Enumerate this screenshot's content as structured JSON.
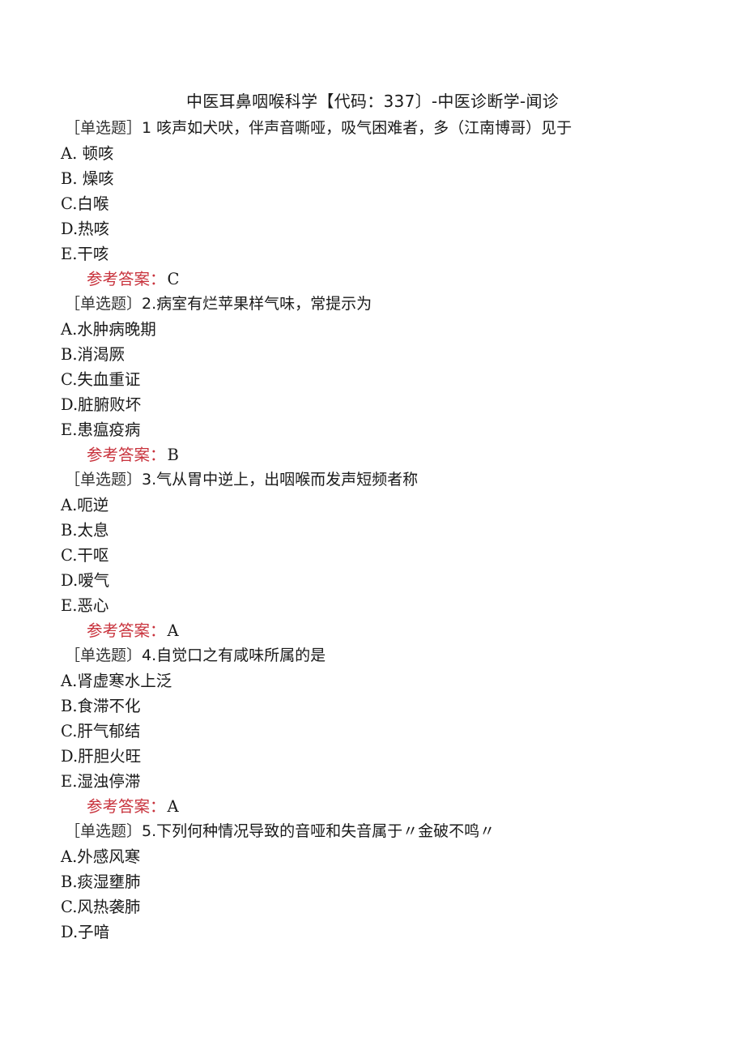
{
  "document": {
    "title": "中医耳鼻咽喉科学【代码：337〕-中医诊断学-闻诊",
    "answer_label": "参考答案：",
    "accent_color": "#c8323c",
    "questions": [
      {
        "type": "［单选题］",
        "stem": "1 咳声如犬吠，伴声音嘶哑，吸气困难者，多（江南博哥）见于",
        "options": [
          "A. 顿咳",
          "B. 燥咳",
          "C.白喉",
          "D.热咳",
          "E.干咳"
        ],
        "answer": "C"
      },
      {
        "type": "［单选题〕",
        "stem": "2.病室有烂苹果样气味，常提示为",
        "options": [
          "A.水肿病晚期",
          "B.消渴厥",
          "C.失血重证",
          "D.脏腑败坏",
          "E.患瘟疫病"
        ],
        "answer": "B"
      },
      {
        "type": "［单选题〕",
        "stem": "3.气从胃中逆上，出咽喉而发声短频者称",
        "options": [
          "A.呃逆",
          "B.太息",
          "C.干呕",
          "D.嗳气",
          "E.恶心"
        ],
        "answer": "A"
      },
      {
        "type": "［单选题〕",
        "stem": "4.自觉口之有咸味所属的是",
        "options": [
          "A.肾虚寒水上泛",
          "B.食滞不化",
          "C.肝气郁结",
          "D.肝胆火旺",
          "E.湿浊停滞"
        ],
        "answer": "A"
      },
      {
        "type": "［单选题〕",
        "stem": "5.下列何种情况导致的音哑和失音属于〃金破不鸣〃",
        "options": [
          "A.外感风寒",
          "B.痰湿壅肺",
          "C.风热袭肺",
          "D.子喑"
        ],
        "answer": null
      }
    ]
  }
}
